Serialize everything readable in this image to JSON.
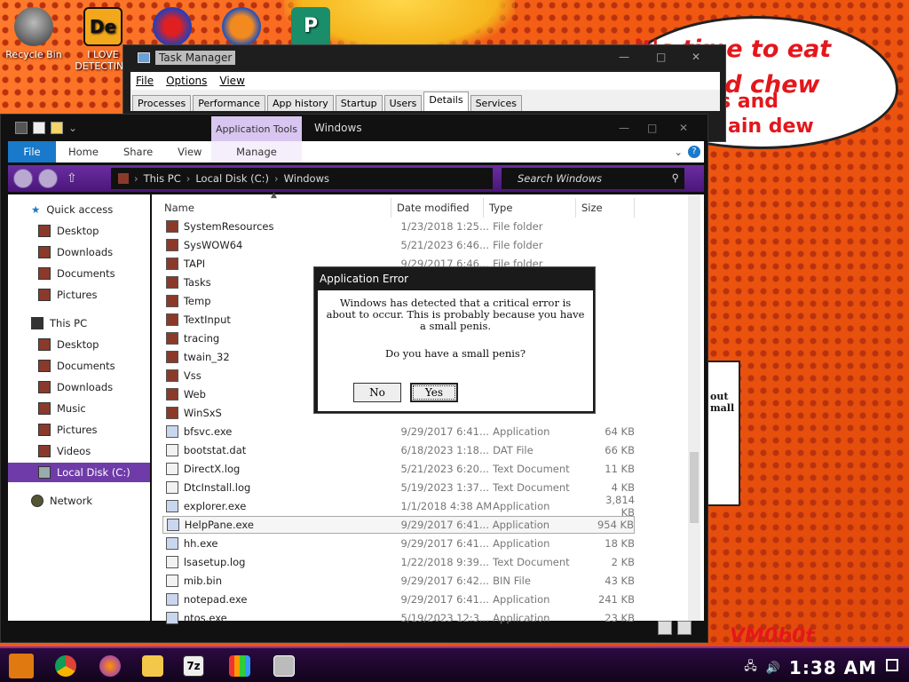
{
  "desktop": {
    "icons": [
      {
        "label": "Recycle Bin",
        "icon": "recycle-bin-icon"
      },
      {
        "label": "I LOVE DETECTING",
        "icon": "detecting-icon"
      },
      {
        "label": "",
        "icon": "app-icon"
      },
      {
        "label": "",
        "icon": "app-icon"
      },
      {
        "label": "",
        "icon": "publisher-icon"
      }
    ],
    "bubble_text": "it's time to eat shit and chew",
    "bubble_fragment_1": "s and",
    "bubble_fragment_2": "ain dew",
    "watermark": "VM0b0t"
  },
  "task_manager": {
    "title": "Task Manager",
    "menu": [
      "File",
      "Options",
      "View"
    ],
    "tabs": [
      "Processes",
      "Performance",
      "App history",
      "Startup",
      "Users",
      "Details",
      "Services"
    ],
    "active_tab": "Details"
  },
  "explorer": {
    "context_tab": "Application Tools",
    "window_title": "Windows",
    "ribbon_tabs": [
      "File",
      "Home",
      "Share",
      "View"
    ],
    "ribbon_manage": "Manage",
    "breadcrumb": [
      "This PC",
      "Local Disk (C:)",
      "Windows"
    ],
    "search_placeholder": "Search Windows",
    "nav": {
      "quick_access": "Quick access",
      "quick_items": [
        "Desktop",
        "Downloads",
        "Documents",
        "Pictures"
      ],
      "this_pc": "This PC",
      "pc_items": [
        "Desktop",
        "Documents",
        "Downloads",
        "Music",
        "Pictures",
        "Videos",
        "Local Disk (C:)"
      ],
      "network": "Network"
    },
    "columns": [
      "Name",
      "Date modified",
      "Type",
      "Size"
    ],
    "files": [
      {
        "name": "SystemResources",
        "date": "1/23/2018 1:25...",
        "type": "File folder",
        "size": ""
      },
      {
        "name": "SysWOW64",
        "date": "5/21/2023 6:46...",
        "type": "File folder",
        "size": ""
      },
      {
        "name": "TAPI",
        "date": "9/29/2017 6:46...",
        "type": "File folder",
        "size": ""
      },
      {
        "name": "Tasks",
        "date": "",
        "type": "",
        "size": ""
      },
      {
        "name": "Temp",
        "date": "",
        "type": "",
        "size": ""
      },
      {
        "name": "TextInput",
        "date": "",
        "type": "",
        "size": ""
      },
      {
        "name": "tracing",
        "date": "",
        "type": "",
        "size": ""
      },
      {
        "name": "twain_32",
        "date": "",
        "type": "",
        "size": ""
      },
      {
        "name": "Vss",
        "date": "",
        "type": "",
        "size": ""
      },
      {
        "name": "Web",
        "date": "",
        "type": "",
        "size": ""
      },
      {
        "name": "WinSxS",
        "date": "",
        "type": "",
        "size": ""
      },
      {
        "name": "bfsvc.exe",
        "date": "9/29/2017 6:41...",
        "type": "Application",
        "size": "64 KB"
      },
      {
        "name": "bootstat.dat",
        "date": "6/18/2023 1:18...",
        "type": "DAT File",
        "size": "66 KB"
      },
      {
        "name": "DirectX.log",
        "date": "5/21/2023 6:20...",
        "type": "Text Document",
        "size": "11 KB"
      },
      {
        "name": "DtcInstall.log",
        "date": "5/19/2023 1:37...",
        "type": "Text Document",
        "size": "4 KB"
      },
      {
        "name": "explorer.exe",
        "date": "1/1/2018 4:38 AM",
        "type": "Application",
        "size": "3,814 KB"
      },
      {
        "name": "HelpPane.exe",
        "date": "9/29/2017 6:41...",
        "type": "Application",
        "size": "954 KB"
      },
      {
        "name": "hh.exe",
        "date": "9/29/2017 6:41...",
        "type": "Application",
        "size": "18 KB"
      },
      {
        "name": "lsasetup.log",
        "date": "1/22/2018 9:39...",
        "type": "Text Document",
        "size": "2 KB"
      },
      {
        "name": "mib.bin",
        "date": "9/29/2017 6:42...",
        "type": "BIN File",
        "size": "43 KB"
      },
      {
        "name": "notepad.exe",
        "date": "9/29/2017 6:41...",
        "type": "Application",
        "size": "241 KB"
      },
      {
        "name": "ntos.exe",
        "date": "5/19/2023 12:3...",
        "type": "Application",
        "size": "23 KB"
      }
    ]
  },
  "dialog": {
    "title": "Application Error",
    "message": "Windows has detected that a critical error is about to occur. This is probably because you have a small penis.",
    "question": "Do you have a small penis?",
    "no_label": "No",
    "yes_label": "Yes"
  },
  "bg_dialog": {
    "fragment_1": "out",
    "fragment_2": "mall"
  },
  "taskbar": {
    "apps": [
      "chrome-icon",
      "firefox-icon",
      "file-explorer-icon",
      "7zip-icon",
      "chart-app-icon",
      "task-manager-icon"
    ],
    "app_7z_label": "7z",
    "clock": "1:38 AM"
  },
  "colors": {
    "accent_purple": "#6e3ba8",
    "file_tab_blue": "#1979ca",
    "bubble_red": "#e3171c"
  }
}
